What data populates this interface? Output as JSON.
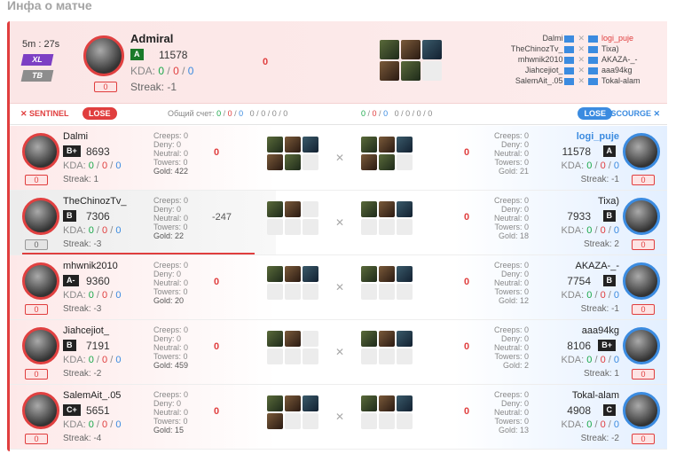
{
  "page_title": "Инфа о матче",
  "summary": {
    "game_time": "5m : 27s",
    "badge1": "XL",
    "badge2": "TB",
    "player": "Admiral",
    "rank": "A",
    "mmr": "11578",
    "kda": {
      "label": "KDA:",
      "k": "0",
      "d": "0",
      "a": "0"
    },
    "streak": "Streak: -1",
    "lh": "0",
    "gold": "0",
    "lineup": [
      {
        "left": "Dalmi",
        "right": "logi_puje"
      },
      {
        "left": "TheChinozTv_",
        "right": "Tixa)"
      },
      {
        "left": "mhwnik2010",
        "right": "AKAZA-_-"
      },
      {
        "left": "Jiahcejiot_",
        "right": "aaa94kg"
      },
      {
        "left": "SalemAit_.05",
        "right": "Tokal-alam"
      }
    ]
  },
  "teams": {
    "sentinel": "SENTINEL",
    "scourge": "SCOURGE",
    "left_result": "LOSE",
    "right_result": "LOSE",
    "total_score_label": "Общий счет:",
    "left_score": {
      "a": "0",
      "b": "0",
      "c": "0",
      "d": "0",
      "e": "0",
      "f": "0",
      "g": "0"
    },
    "right_score": {
      "a": "0",
      "b": "0",
      "c": "0",
      "d": "0",
      "e": "0",
      "f": "0",
      "g": "0"
    }
  },
  "labels": {
    "kda": "KDA:",
    "vs": "✕"
  },
  "rows": [
    {
      "left": {
        "name": "Dalmi",
        "rank": "B+",
        "mmr": "8693",
        "k": "0",
        "d": "0",
        "a": "0",
        "streak": "Streak: 1",
        "lh": "0",
        "creeps": "Creeps: 0",
        "deny": "Deny: 0",
        "neutral": "Neutral: 0",
        "towers": "Towers: 0",
        "gold": "Gold: 422",
        "diff": "0",
        "items": 5
      },
      "right": {
        "name": "logi_puje",
        "rank": "A",
        "mmr": "11578",
        "k": "0",
        "d": "0",
        "a": "0",
        "streak": "Streak: -1",
        "lh": "0",
        "creeps": "Creeps: 0",
        "deny": "Deny: 0",
        "neutral": "Neutral: 0",
        "towers": "Towers: 0",
        "gold": "Gold: 21",
        "diff": "0",
        "items": 5
      }
    },
    {
      "left": {
        "name": "TheChinozTv_",
        "rank": "B",
        "mmr": "7306",
        "k": "0",
        "d": "0",
        "a": "0",
        "streak": "Streak: -3",
        "lh": "0",
        "creeps": "Creeps: 0",
        "deny": "Deny: 0",
        "neutral": "Neutral: 0",
        "towers": "Towers: 0",
        "gold": "Gold: 22",
        "diff": "-247",
        "items": 2
      },
      "right": {
        "name": "Tixa)",
        "rank": "B",
        "mmr": "7933",
        "k": "0",
        "d": "0",
        "a": "0",
        "streak": "Streak: 2",
        "lh": "0",
        "creeps": "Creeps: 0",
        "deny": "Deny: 0",
        "neutral": "Neutral: 0",
        "towers": "Towers: 0",
        "gold": "Gold: 18",
        "diff": "0",
        "items": 3
      }
    },
    {
      "left": {
        "name": "mhwnik2010",
        "rank": "A-",
        "mmr": "9360",
        "k": "0",
        "d": "0",
        "a": "0",
        "streak": "Streak: -3",
        "lh": "0",
        "creeps": "Creeps: 0",
        "deny": "Deny: 0",
        "neutral": "Neutral: 0",
        "towers": "Towers: 0",
        "gold": "Gold: 20",
        "diff": "0",
        "items": 3
      },
      "right": {
        "name": "AKAZA-_-",
        "rank": "B",
        "mmr": "7754",
        "k": "0",
        "d": "0",
        "a": "0",
        "streak": "Streak: -1",
        "lh": "0",
        "creeps": "Creeps: 0",
        "deny": "Deny: 0",
        "neutral": "Neutral: 0",
        "towers": "Towers: 0",
        "gold": "Gold: 12",
        "diff": "0",
        "items": 3
      }
    },
    {
      "left": {
        "name": "Jiahcejiot_",
        "rank": "B",
        "mmr": "7191",
        "k": "0",
        "d": "0",
        "a": "0",
        "streak": "Streak: -2",
        "lh": "0",
        "creeps": "Creeps: 0",
        "deny": "Deny: 0",
        "neutral": "Neutral: 0",
        "towers": "Towers: 0",
        "gold": "Gold: 459",
        "diff": "0",
        "items": 2
      },
      "right": {
        "name": "aaa94kg",
        "rank": "B+",
        "mmr": "8106",
        "k": "0",
        "d": "0",
        "a": "0",
        "streak": "Streak: 1",
        "lh": "0",
        "creeps": "Creeps: 0",
        "deny": "Deny: 0",
        "neutral": "Neutral: 0",
        "towers": "Towers: 0",
        "gold": "Gold: 2",
        "diff": "0",
        "items": 3
      }
    },
    {
      "left": {
        "name": "SalemAit_.05",
        "rank": "C+",
        "mmr": "5651",
        "k": "0",
        "d": "0",
        "a": "0",
        "streak": "Streak: -4",
        "lh": "0",
        "creeps": "Creeps: 0",
        "deny": "Deny: 0",
        "neutral": "Neutral: 0",
        "towers": "Towers: 0",
        "gold": "Gold: 15",
        "diff": "0",
        "items": 4
      },
      "right": {
        "name": "Tokal-alam",
        "rank": "C",
        "mmr": "4908",
        "k": "0",
        "d": "0",
        "a": "0",
        "streak": "Streak: -2",
        "lh": "0",
        "creeps": "Creeps: 0",
        "deny": "Deny: 0",
        "neutral": "Neutral: 0",
        "towers": "Towers: 0",
        "gold": "Gold: 13",
        "diff": "0",
        "items": 3
      }
    }
  ],
  "colors": {
    "sentinel": "#e03e3e",
    "scourge": "#3b8be0",
    "xl": "#7c3fc4"
  }
}
